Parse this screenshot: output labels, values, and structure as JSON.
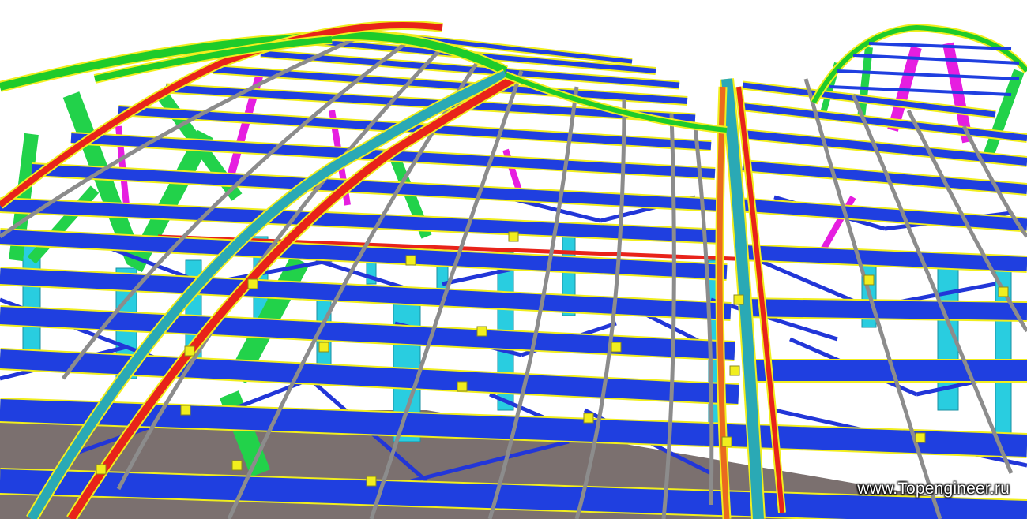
{
  "image": {
    "subject": "steel-frame-roof-model",
    "watermark": "www.Topengineer.ru"
  },
  "colors": {
    "purlin": "#1f3fe0",
    "flange": "#f1ee1e",
    "rafter": "#8c8c8c",
    "arch_green": "#1ecb2a",
    "arch_red": "#e8231a",
    "arch_teal": "#2aa9b5",
    "column": "#29cde0",
    "strut_green": "#22d24a",
    "strut_magenta": "#e61ee0",
    "brace": "#2236d8",
    "floor": "#7b706f",
    "sky": "#ffffff"
  }
}
